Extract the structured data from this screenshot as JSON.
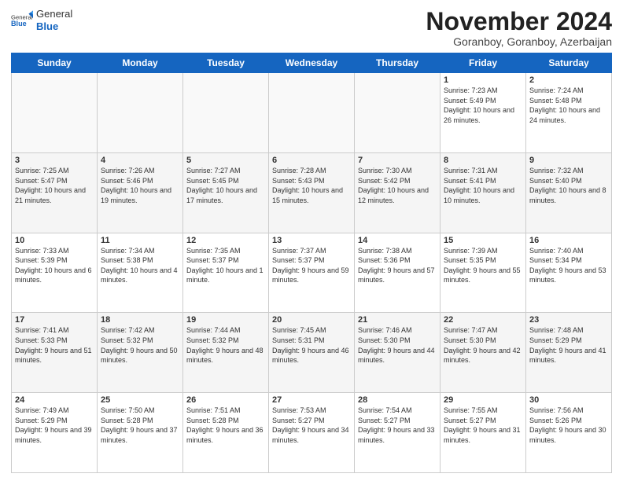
{
  "logo": {
    "general": "General",
    "blue": "Blue"
  },
  "header": {
    "month": "November 2024",
    "location": "Goranboy, Goranboy, Azerbaijan"
  },
  "days_of_week": [
    "Sunday",
    "Monday",
    "Tuesday",
    "Wednesday",
    "Thursday",
    "Friday",
    "Saturday"
  ],
  "weeks": [
    [
      {
        "day": "",
        "info": ""
      },
      {
        "day": "",
        "info": ""
      },
      {
        "day": "",
        "info": ""
      },
      {
        "day": "",
        "info": ""
      },
      {
        "day": "",
        "info": ""
      },
      {
        "day": "1",
        "info": "Sunrise: 7:23 AM\nSunset: 5:49 PM\nDaylight: 10 hours and 26 minutes."
      },
      {
        "day": "2",
        "info": "Sunrise: 7:24 AM\nSunset: 5:48 PM\nDaylight: 10 hours and 24 minutes."
      }
    ],
    [
      {
        "day": "3",
        "info": "Sunrise: 7:25 AM\nSunset: 5:47 PM\nDaylight: 10 hours and 21 minutes."
      },
      {
        "day": "4",
        "info": "Sunrise: 7:26 AM\nSunset: 5:46 PM\nDaylight: 10 hours and 19 minutes."
      },
      {
        "day": "5",
        "info": "Sunrise: 7:27 AM\nSunset: 5:45 PM\nDaylight: 10 hours and 17 minutes."
      },
      {
        "day": "6",
        "info": "Sunrise: 7:28 AM\nSunset: 5:43 PM\nDaylight: 10 hours and 15 minutes."
      },
      {
        "day": "7",
        "info": "Sunrise: 7:30 AM\nSunset: 5:42 PM\nDaylight: 10 hours and 12 minutes."
      },
      {
        "day": "8",
        "info": "Sunrise: 7:31 AM\nSunset: 5:41 PM\nDaylight: 10 hours and 10 minutes."
      },
      {
        "day": "9",
        "info": "Sunrise: 7:32 AM\nSunset: 5:40 PM\nDaylight: 10 hours and 8 minutes."
      }
    ],
    [
      {
        "day": "10",
        "info": "Sunrise: 7:33 AM\nSunset: 5:39 PM\nDaylight: 10 hours and 6 minutes."
      },
      {
        "day": "11",
        "info": "Sunrise: 7:34 AM\nSunset: 5:38 PM\nDaylight: 10 hours and 4 minutes."
      },
      {
        "day": "12",
        "info": "Sunrise: 7:35 AM\nSunset: 5:37 PM\nDaylight: 10 hours and 1 minute."
      },
      {
        "day": "13",
        "info": "Sunrise: 7:37 AM\nSunset: 5:37 PM\nDaylight: 9 hours and 59 minutes."
      },
      {
        "day": "14",
        "info": "Sunrise: 7:38 AM\nSunset: 5:36 PM\nDaylight: 9 hours and 57 minutes."
      },
      {
        "day": "15",
        "info": "Sunrise: 7:39 AM\nSunset: 5:35 PM\nDaylight: 9 hours and 55 minutes."
      },
      {
        "day": "16",
        "info": "Sunrise: 7:40 AM\nSunset: 5:34 PM\nDaylight: 9 hours and 53 minutes."
      }
    ],
    [
      {
        "day": "17",
        "info": "Sunrise: 7:41 AM\nSunset: 5:33 PM\nDaylight: 9 hours and 51 minutes."
      },
      {
        "day": "18",
        "info": "Sunrise: 7:42 AM\nSunset: 5:32 PM\nDaylight: 9 hours and 50 minutes."
      },
      {
        "day": "19",
        "info": "Sunrise: 7:44 AM\nSunset: 5:32 PM\nDaylight: 9 hours and 48 minutes."
      },
      {
        "day": "20",
        "info": "Sunrise: 7:45 AM\nSunset: 5:31 PM\nDaylight: 9 hours and 46 minutes."
      },
      {
        "day": "21",
        "info": "Sunrise: 7:46 AM\nSunset: 5:30 PM\nDaylight: 9 hours and 44 minutes."
      },
      {
        "day": "22",
        "info": "Sunrise: 7:47 AM\nSunset: 5:30 PM\nDaylight: 9 hours and 42 minutes."
      },
      {
        "day": "23",
        "info": "Sunrise: 7:48 AM\nSunset: 5:29 PM\nDaylight: 9 hours and 41 minutes."
      }
    ],
    [
      {
        "day": "24",
        "info": "Sunrise: 7:49 AM\nSunset: 5:29 PM\nDaylight: 9 hours and 39 minutes."
      },
      {
        "day": "25",
        "info": "Sunrise: 7:50 AM\nSunset: 5:28 PM\nDaylight: 9 hours and 37 minutes."
      },
      {
        "day": "26",
        "info": "Sunrise: 7:51 AM\nSunset: 5:28 PM\nDaylight: 9 hours and 36 minutes."
      },
      {
        "day": "27",
        "info": "Sunrise: 7:53 AM\nSunset: 5:27 PM\nDaylight: 9 hours and 34 minutes."
      },
      {
        "day": "28",
        "info": "Sunrise: 7:54 AM\nSunset: 5:27 PM\nDaylight: 9 hours and 33 minutes."
      },
      {
        "day": "29",
        "info": "Sunrise: 7:55 AM\nSunset: 5:27 PM\nDaylight: 9 hours and 31 minutes."
      },
      {
        "day": "30",
        "info": "Sunrise: 7:56 AM\nSunset: 5:26 PM\nDaylight: 9 hours and 30 minutes."
      }
    ]
  ]
}
